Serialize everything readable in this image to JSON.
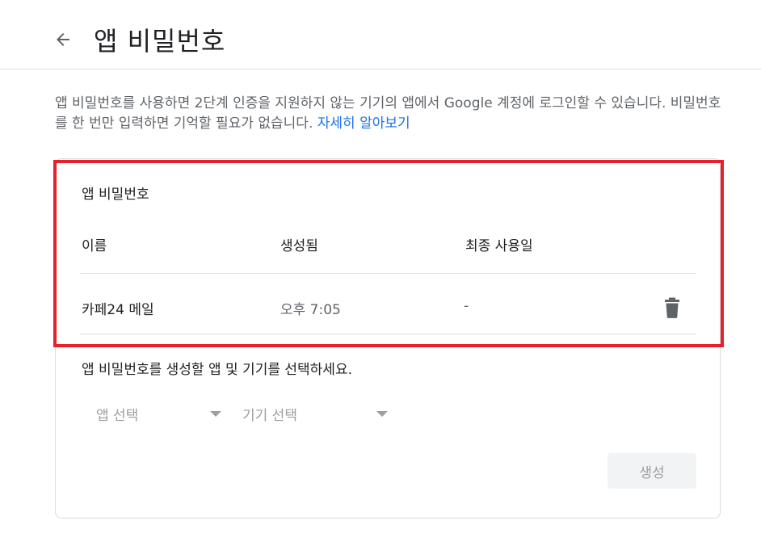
{
  "header": {
    "title": "앱 비밀번호",
    "back_icon": "arrow-back-icon"
  },
  "description": {
    "text": "앱 비밀번호를 사용하면 2단계 인증을 지원하지 않는 기기의 앱에서 Google 계정에 로그인할 수 있습니다. 비밀번호를 한 번만 입력하면 기억할 필요가 없습니다. ",
    "link_label": "자세히 알아보기"
  },
  "card": {
    "section_title": "앱 비밀번호",
    "columns": [
      "이름",
      "생성됨",
      "최종 사용일"
    ],
    "rows": [
      {
        "name": "카페24 메일",
        "created": "오후 7:05",
        "last_used": "-",
        "delete_icon": "trash-icon"
      }
    ],
    "instruction": "앱 비밀번호를 생성할 앱 및 기기를 선택하세요.",
    "app_select": "앱 선택",
    "device_select": "기기 선택",
    "generate_label": "생성"
  },
  "colors": {
    "highlight": "#e8202a",
    "link": "#1a73e8",
    "muted_text": "#9e9e9e"
  }
}
